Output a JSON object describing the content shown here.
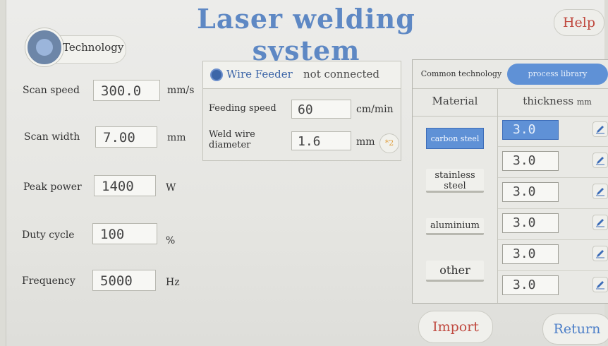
{
  "header": {
    "title": "Laser welding system",
    "help_label": "Help"
  },
  "tech_tab": {
    "label": "Technology",
    "icon": "gear-icon"
  },
  "params": {
    "scan_speed": {
      "label": "Scan speed",
      "value": "300.0",
      "unit": "mm/s"
    },
    "scan_width": {
      "label": "Scan width",
      "value": "7.00",
      "unit": "mm"
    },
    "peak_power": {
      "label": "Peak power",
      "value": "1400",
      "unit": "W"
    },
    "duty_cycle": {
      "label": "Duty cycle",
      "value": "100",
      "unit": "%"
    },
    "frequency": {
      "label": "Frequency",
      "value": "5000",
      "unit": "Hz"
    }
  },
  "wire_feeder": {
    "title": "Wire Feeder",
    "status": "not connected",
    "feeding_speed": {
      "label": "Feeding speed",
      "value": "60",
      "unit": "cm/min"
    },
    "wire_diameter": {
      "label_line1": "Weld wire",
      "label_line2": "diameter",
      "value": "1.6",
      "unit": "mm"
    },
    "multiplier_label": "*2"
  },
  "library": {
    "tab_common": "Common technology",
    "tab_process": "process library",
    "col_material": "Material",
    "col_thickness": "thickness",
    "col_thickness_unit": "mm",
    "materials": [
      {
        "line1": "carbon steel",
        "line2": ""
      },
      {
        "line1": "stainless",
        "line2": "steel"
      },
      {
        "line1": "aluminium",
        "line2": ""
      },
      {
        "line1": "other",
        "line2": ""
      }
    ],
    "thicknesses": [
      "3.0",
      "3.0",
      "3.0",
      "3.0",
      "3.0",
      "3.0"
    ]
  },
  "footer": {
    "import_label": "Import",
    "return_label": "Return"
  },
  "colors": {
    "accent_blue": "#5f91d6",
    "title_blue": "#5e88c4",
    "alert_red": "#c04a40"
  }
}
